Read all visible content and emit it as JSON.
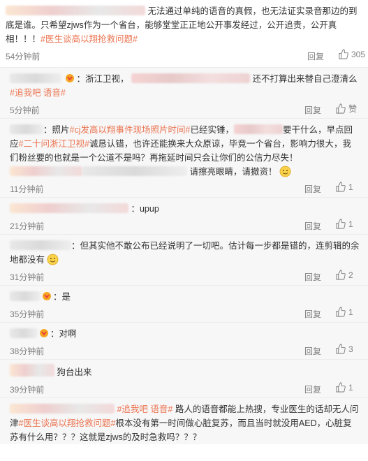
{
  "main": {
    "text_a": "无法通过单纯的语音的真假，也无法证实录音那边的到底是谁。只希望zjws作为一个省台，能够堂堂正正地公开事发经过，公开追责，公开真相！！！",
    "tag": "#医生谈高以翔抢救问题#",
    "time": "54分钟前",
    "reply_label": "回复",
    "like_count": "305"
  },
  "replies": [
    {
      "prefix": "：浙江卫视，",
      "text": "还不打算出来替自己澄清么",
      "tag": "#追我吧 语音#",
      "time": "5分钟前",
      "reply_label": "回复",
      "like_label": "赞"
    },
    {
      "p1": "：照片",
      "tag1": "#cj发高以翔事件现场照片时间#",
      "p2": "已经实锤，",
      "p3": "要干什么，早点回应",
      "tag2": "#二十问浙江卫视#",
      "p4": "诚恳认错，也许还能换来大众原谅，毕竟一个省台，影响力很大，我们粉丝要的也就是一个公道不是吗？再拖延时间只会让你们的公信力尽失！",
      "p5": "请擦亮眼睛，请撤资！",
      "time": "11分钟前",
      "reply_label": "回复",
      "like_count": "1"
    },
    {
      "text": "：upup",
      "time": "21分钟前",
      "reply_label": "回复",
      "like_count": "1"
    },
    {
      "text": "：但其实他不敢公布已经说明了一切吧。估计每一步都是错的，连剪辑的余地都没有",
      "time": "31分钟前",
      "reply_label": "回复",
      "like_count": "2"
    },
    {
      "text": "：是",
      "time": "35分钟前",
      "reply_label": "回复",
      "like_count": "1"
    },
    {
      "text": "：对啊",
      "time": "38分钟前",
      "reply_label": "回复",
      "like_count": "3"
    },
    {
      "text": "狗台出来",
      "time": "39分钟前",
      "reply_label": "回复",
      "like_count": "1"
    },
    {
      "tag1": "#追我吧 语音#",
      "p1": "路人的语音都能上热搜，专业医生的话却无人问津",
      "tag2": "#医生谈高以翔抢救问题#",
      "p2": "根本没有第一时间做心脏复苏，而且当时就没用AED，心脏复苏有什么用？？？这就是zjws的及时急救吗？？？"
    }
  ],
  "colors": {
    "tag": "#eb7350",
    "meta": "#808080",
    "reply_bg": "#f7f7f7"
  },
  "icons": {
    "like": "thumb-up-icon",
    "badge": "fan-badge-icon",
    "emoji": "smile-emoji-icon"
  }
}
